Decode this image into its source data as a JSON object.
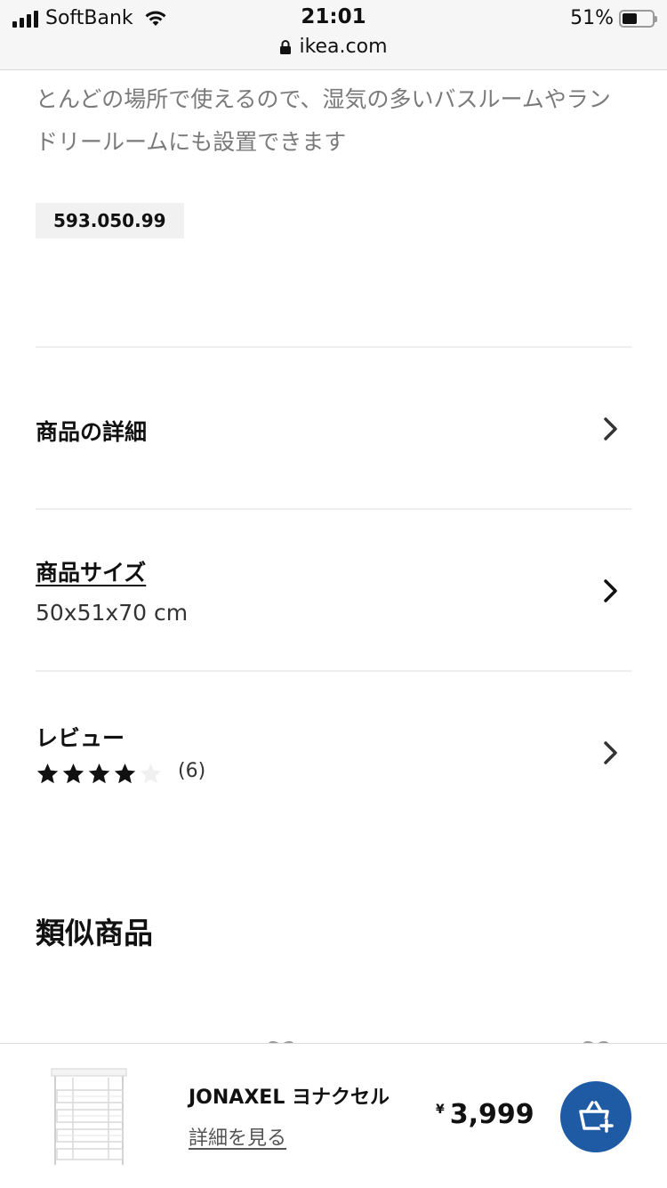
{
  "status_bar": {
    "carrier": "SoftBank",
    "time": "21:01",
    "battery_percent": "51%",
    "battery_level": 0.51,
    "url": "ikea.com"
  },
  "description": "とんどの場所で使えるので、湿気の多いバスルームやランドリールームにも設置できます",
  "article_number": "593.050.99",
  "sections": {
    "details": {
      "title": "商品の詳細"
    },
    "size": {
      "title": "商品サイズ",
      "value": "50x51x70 cm"
    },
    "reviews": {
      "title": "レビュー",
      "count": "(6)",
      "rating": 4,
      "max_rating": 5
    }
  },
  "similar_products": {
    "title": "類似商品"
  },
  "bottom_bar": {
    "product_name": "JONAXEL ヨナクセル",
    "details_link": "詳細を見る",
    "currency": "¥",
    "price": "3,999"
  },
  "colors": {
    "accent": "#1f5aa5",
    "star_filled": "#111111",
    "star_empty": "#f0f0f0"
  },
  "icons": [
    "signal-icon",
    "wifi-icon",
    "battery-icon",
    "lock-icon",
    "chevron-right-icon",
    "star-icon",
    "heart-icon",
    "cart-add-icon"
  ]
}
